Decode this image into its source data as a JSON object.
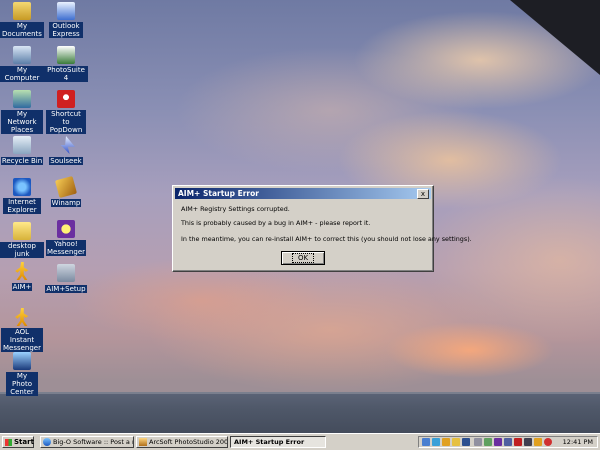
{
  "desktop": {
    "icons": [
      {
        "label": "My Documents",
        "icon": "my-documents-icon"
      },
      {
        "label": "Outlook Express",
        "icon": "outlook-express-icon"
      },
      {
        "label": "My Computer",
        "icon": "my-computer-icon"
      },
      {
        "label": "PhotoSuite 4",
        "icon": "photosuite-icon"
      },
      {
        "label": "My Network Places",
        "icon": "network-places-icon"
      },
      {
        "label": "Shortcut to PopDown",
        "icon": "popdown-icon"
      },
      {
        "label": "Recycle Bin",
        "icon": "recycle-bin-icon"
      },
      {
        "label": "Soulseek",
        "icon": "soulseek-icon"
      },
      {
        "label": "Internet Explorer",
        "icon": "internet-explorer-icon"
      },
      {
        "label": "Winamp",
        "icon": "winamp-icon"
      },
      {
        "label": "desktop junk",
        "icon": "folder-icon"
      },
      {
        "label": "Yahoo! Messenger",
        "icon": "yahoo-messenger-icon"
      },
      {
        "label": "AIM+",
        "icon": "aim-icon"
      },
      {
        "label": "AIM+Setup",
        "icon": "aim-setup-icon"
      },
      {
        "label": "AOL Instant Messenger",
        "icon": "aol-instant-messenger-icon"
      },
      {
        "label": "My Photo Center",
        "icon": "photo-center-icon"
      }
    ]
  },
  "dialog": {
    "title": "AIM+ Startup Error",
    "close_label": "x",
    "line1": "AIM+ Registry Settings corrupted.",
    "line2": "This is probably caused by a bug in AIM+ - please report it.",
    "line3": "In the meantime, you can re-install AIM+ to correct this (you should not lose any settings).",
    "ok_label": "OK"
  },
  "taskbar": {
    "start_label": "Start",
    "tasks": [
      {
        "label": "Big-O Software :: Post a n...",
        "icon": "browser-icon"
      },
      {
        "label": "ArcSoft PhotoStudio 2000",
        "icon": "photostudio-icon"
      },
      {
        "label": "AIM+ Startup Error",
        "icon": "aim-icon"
      }
    ],
    "clock": "12:41 PM"
  },
  "colors": {
    "titlebar_start": "#0a246a",
    "titlebar_end": "#a6caf0",
    "window_face": "#d4d0c8",
    "label_bg": "#10306a"
  }
}
